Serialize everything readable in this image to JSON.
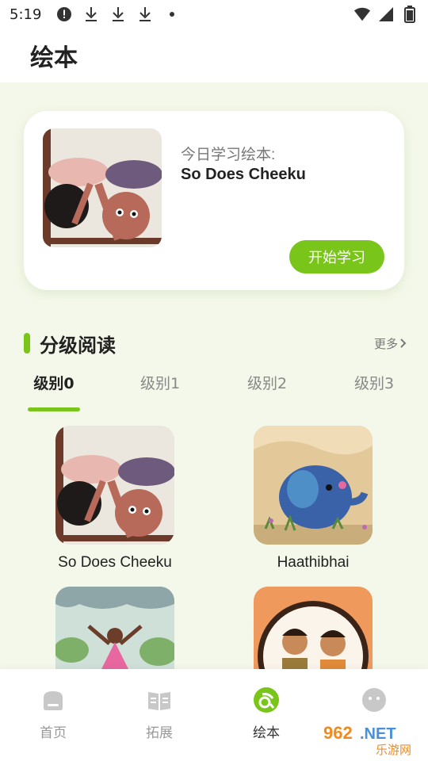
{
  "status_bar": {
    "time": "5:19",
    "left_icons": [
      "alert-circle-icon",
      "download-icon",
      "download-icon",
      "download-icon",
      "dot-icon"
    ],
    "right_icons": [
      "wifi-icon",
      "signal-icon",
      "battery-icon"
    ]
  },
  "header": {
    "title": "绘本"
  },
  "today": {
    "label": "今日学习绘本:",
    "title": "So Does Cheeku",
    "start_label": "开始学习"
  },
  "section": {
    "title": "分级阅读",
    "more_label": "更多"
  },
  "level_tabs": [
    {
      "label": "级别0",
      "active": true
    },
    {
      "label": "级别1",
      "active": false
    },
    {
      "label": "级别2",
      "active": false
    },
    {
      "label": "级别3",
      "active": false
    }
  ],
  "books": [
    {
      "title": "So Does Cheeku"
    },
    {
      "title": "Haathibhai"
    },
    {
      "title": ""
    },
    {
      "title": ""
    }
  ],
  "bottom_nav": [
    {
      "label": "首页",
      "icon": "home-icon",
      "active": false
    },
    {
      "label": "拓展",
      "icon": "book-open-icon",
      "active": false
    },
    {
      "label": "绘本",
      "icon": "picture-book-icon",
      "active": true
    },
    {
      "label": "",
      "icon": "profile-face-icon",
      "active": false
    }
  ],
  "watermark": {
    "text_top": "962.NET",
    "text_bottom": "乐游网"
  },
  "colors": {
    "accent": "#79c51a",
    "background": "#f4f8ea",
    "card": "#ffffff"
  }
}
